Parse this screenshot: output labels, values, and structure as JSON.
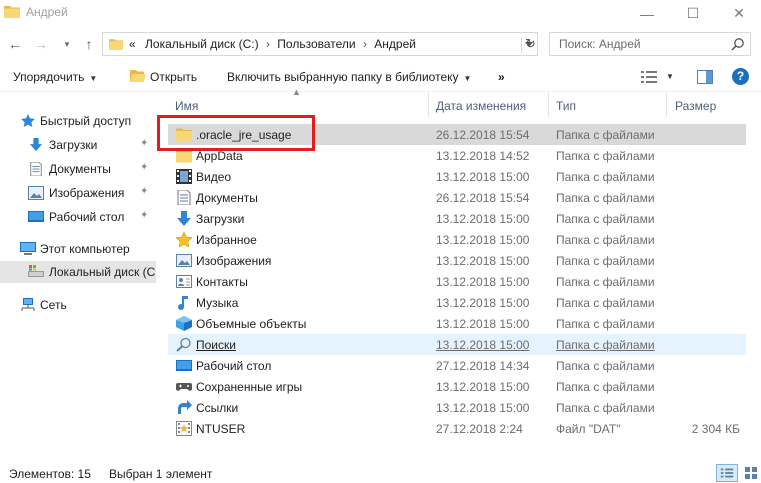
{
  "window": {
    "title": "Андрей",
    "minimize": "—",
    "maximize": "☐",
    "close": "✕"
  },
  "nav": {
    "back": "←",
    "forward": "→",
    "recent": "▾",
    "up": "↑",
    "address_prefix": "«",
    "breadcrumbs": [
      "Локальный диск (C:)",
      "Пользователи",
      "Андрей"
    ],
    "breadcrumb_sep": "›",
    "search_placeholder": "Поиск: Андрей",
    "refresh": "↻"
  },
  "toolbar": {
    "organize": "Упорядочить",
    "open": "Открыть",
    "include_library": "Включить выбранную папку в библиотеку",
    "more": "»",
    "help": "?"
  },
  "navpane": {
    "items": [
      {
        "label": "Быстрый доступ",
        "icon": "star-icon",
        "pinned": false
      },
      {
        "label": "Загрузки",
        "icon": "download-icon",
        "pinned": true
      },
      {
        "label": "Документы",
        "icon": "document-icon",
        "pinned": true
      },
      {
        "label": "Изображения",
        "icon": "image-icon",
        "pinned": true
      },
      {
        "label": "Рабочий стол",
        "icon": "desktop-icon",
        "pinned": true
      },
      {
        "label": "Этот компьютер",
        "icon": "computer-icon",
        "pinned": false
      },
      {
        "label": "Локальный диск (C",
        "icon": "drive-icon",
        "pinned": false
      },
      {
        "label": "Сеть",
        "icon": "network-icon",
        "pinned": false
      }
    ],
    "pin_glyph": "📌"
  },
  "columns": {
    "name": "Имя",
    "date": "Дата изменения",
    "type": "Тип",
    "size": "Размер",
    "sort_glyph": "▲"
  },
  "files": [
    {
      "name": ".oracle_jre_usage",
      "date": "26.12.2018 15:54",
      "type": "Папка с файлами",
      "size": "",
      "icon": "folder-icon"
    },
    {
      "name": "AppData",
      "date": "13.12.2018 14:52",
      "type": "Папка с файлами",
      "size": "",
      "icon": "folder-icon"
    },
    {
      "name": "Видео",
      "date": "13.12.2018 15:00",
      "type": "Папка с файлами",
      "size": "",
      "icon": "video-icon"
    },
    {
      "name": "Документы",
      "date": "26.12.2018 15:54",
      "type": "Папка с файлами",
      "size": "",
      "icon": "document-icon"
    },
    {
      "name": "Загрузки",
      "date": "13.12.2018 15:00",
      "type": "Папка с файлами",
      "size": "",
      "icon": "download-icon"
    },
    {
      "name": "Избранное",
      "date": "13.12.2018 15:00",
      "type": "Папка с файлами",
      "size": "",
      "icon": "star-icon"
    },
    {
      "name": "Изображения",
      "date": "13.12.2018 15:00",
      "type": "Папка с файлами",
      "size": "",
      "icon": "image-icon"
    },
    {
      "name": "Контакты",
      "date": "13.12.2018 15:00",
      "type": "Папка с файлами",
      "size": "",
      "icon": "contacts-icon"
    },
    {
      "name": "Музыка",
      "date": "13.12.2018 15:00",
      "type": "Папка с файлами",
      "size": "",
      "icon": "music-icon"
    },
    {
      "name": "Объемные объекты",
      "date": "13.12.2018 15:00",
      "type": "Папка с файлами",
      "size": "",
      "icon": "cube-icon"
    },
    {
      "name": "Поиски",
      "date": "13.12.2018 15:00",
      "type": "Папка с файлами",
      "size": "",
      "icon": "search-icon"
    },
    {
      "name": "Рабочий стол",
      "date": "27.12.2018 14:34",
      "type": "Папка с файлами",
      "size": "",
      "icon": "desktop-icon"
    },
    {
      "name": "Сохраненные игры",
      "date": "13.12.2018 15:00",
      "type": "Папка с файлами",
      "size": "",
      "icon": "gamepad-icon"
    },
    {
      "name": "Ссылки",
      "date": "13.12.2018 15:00",
      "type": "Папка с файлами",
      "size": "",
      "icon": "link-icon"
    },
    {
      "name": "NTUSER",
      "date": "27.12.2018 2:24",
      "type": "Файл \"DAT\"",
      "size": "2 304 КБ",
      "icon": "dat-file-icon"
    }
  ],
  "status": {
    "count": "Элементов: 15",
    "selected": "Выбран 1 элемент"
  },
  "colors": {
    "accent": "#1a6fc0",
    "highlight_box": "#e0201f",
    "folder": "#f8d775",
    "selected_row": "#d9d9d9",
    "hover_row": "#e5f3ff"
  }
}
